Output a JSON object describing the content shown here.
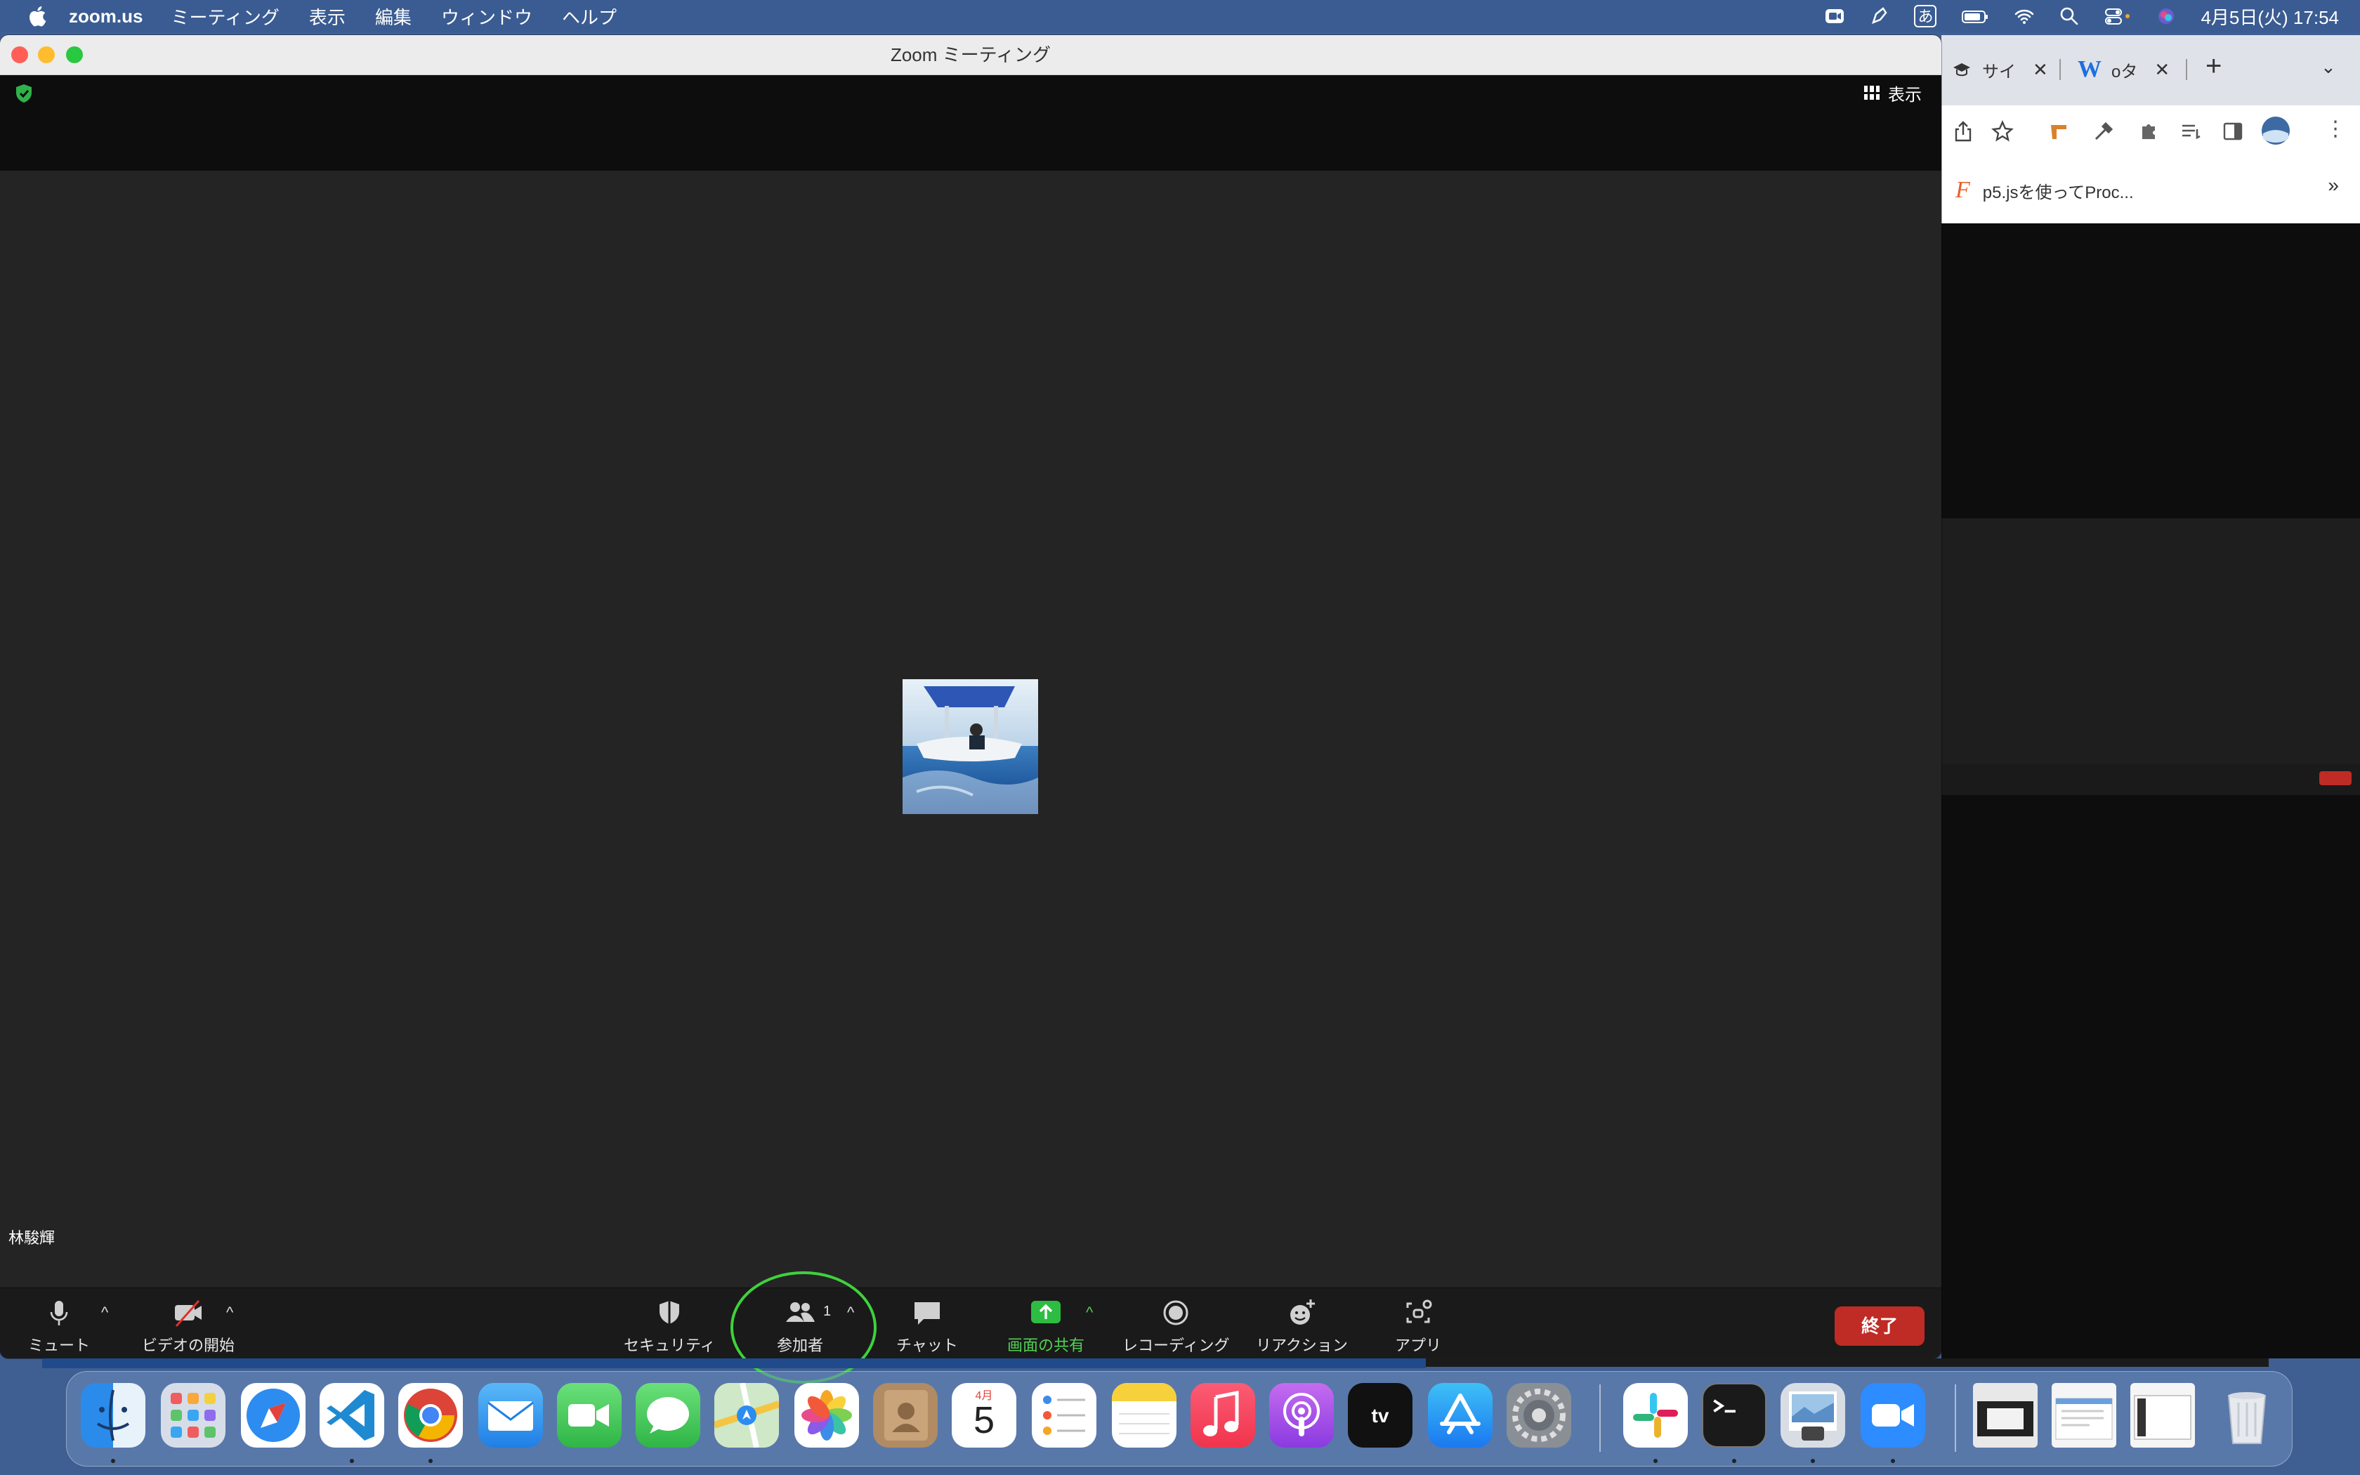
{
  "menubar": {
    "app_name": "zoom.us",
    "menus": [
      "ミーティング",
      "表示",
      "編集",
      "ウィンドウ",
      "ヘルプ"
    ],
    "ime_label": "あ",
    "clock": "4月5日(火)  17:54"
  },
  "zoom_window": {
    "title": "Zoom ミーティング",
    "view_label": "表示",
    "participant_name": "林駿輝",
    "toolbar": {
      "mute": "ミュート",
      "start_video": "ビデオの開始",
      "security": "セキュリティ",
      "participants": "参加者",
      "participants_count": "1",
      "chat": "チャット",
      "share_screen": "画面の共有",
      "recording": "レコーディング",
      "reactions": "リアクション",
      "apps": "アプリ",
      "end": "終了"
    }
  },
  "chrome_window": {
    "tabs": [
      {
        "label": "サイ",
        "icon": "grad-cap-icon"
      },
      {
        "label": "oタ",
        "icon": "wordpress-w-icon"
      }
    ],
    "new_tab": "+",
    "bookmark": "p5.jsを使ってProc...",
    "bookmark_more": "»"
  },
  "dock": {
    "calendar_month": "4月",
    "calendar_day": "5",
    "apps": [
      "finder",
      "launchpad",
      "safari",
      "vscode",
      "chrome",
      "mail",
      "facetime",
      "messages",
      "maps",
      "photos",
      "contacts",
      "calendar",
      "reminders",
      "notes",
      "music",
      "podcasts",
      "tv",
      "app-store",
      "system-preferences",
      "slack",
      "terminal",
      "preview",
      "zoom",
      "window1",
      "window2",
      "window3",
      "trash"
    ]
  }
}
